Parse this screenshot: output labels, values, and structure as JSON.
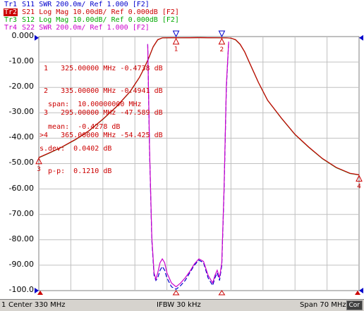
{
  "traces": [
    {
      "id": "Tr1",
      "label": "Tr1",
      "param": "S11",
      "format": "SWR",
      "scale": "200.0m/",
      "ref": "Ref 1.000",
      "channel": "[F2]",
      "color": "#0000cc",
      "active": false
    },
    {
      "id": "Tr2",
      "label": "Tr2",
      "param": "S21",
      "format": "Log Mag",
      "scale": "10.00dB/",
      "ref": "Ref 0.000dB",
      "channel": "[F2]",
      "color": "#cc0000",
      "active": true
    },
    {
      "id": "Tr3",
      "label": "Tr3",
      "param": "S12",
      "format": "Log Mag",
      "scale": "10.00dB/",
      "ref": "Ref 0.000dB",
      "channel": "[F2]",
      "color": "#00aa00",
      "active": false
    },
    {
      "id": "Tr4",
      "label": "Tr4",
      "param": "S22",
      "format": "SWR",
      "scale": "200.0m/",
      "ref": "Ref 1.000",
      "channel": "[F2]",
      "color": "#cc00cc",
      "active": false
    }
  ],
  "y_axis": {
    "ticks": [
      "0.000",
      "-10.00",
      "-20.00",
      "-30.00",
      "-40.00",
      "-50.00",
      "-60.00",
      "-70.00",
      "-80.00",
      "-90.00",
      "-100.0"
    ]
  },
  "markers": {
    "rows": [
      {
        "label": " 1",
        "freq": "325.00000 MHz",
        "value": "-0.4738 dB"
      },
      {
        "label": " 2",
        "freq": "335.00000 MHz",
        "value": "-0.4941 dB"
      },
      {
        "label": " 3",
        "freq": "295.00000 MHz",
        "value": "-47.589 dB"
      },
      {
        "label": ">4",
        "freq": "365.00000 MHz",
        "value": "-54.425 dB"
      }
    ],
    "plot_labels": [
      "1",
      "2",
      "3",
      "4"
    ]
  },
  "statistics": {
    "rows": [
      {
        "name": "  span:",
        "value": "10.00000000 MHz"
      },
      {
        "name": "  mean:",
        "value": "-0.4278 dB"
      },
      {
        "name": "s.dev:",
        "value": "0.0402 dB"
      },
      {
        "name": "  p-p:",
        "value": "0.1210 dB"
      }
    ]
  },
  "status_bar": {
    "channel": "1",
    "center": "Center 330 MHz",
    "ifbw": "IFBW 30 kHz",
    "span": "Span 70 MHz",
    "cor": "Cor"
  },
  "colors": {
    "grid": "#c0c0c0",
    "s21": "#cc0000",
    "s12": "#228b22",
    "s11": "#0000cc",
    "s22": "#cc00cc",
    "marker": "#cc0000",
    "ref_marker": "#0000cc"
  },
  "chart_data": {
    "type": "line",
    "x_unit": "MHz",
    "xlim": [
      295,
      365
    ],
    "ylim": [
      -100,
      0
    ],
    "series": [
      {
        "name": "S21",
        "color": "#cc0000",
        "x": [
          295,
          297,
          300,
          303,
          306,
          309,
          312,
          315,
          317,
          318,
          319,
          320,
          321,
          322,
          324,
          326,
          328,
          330,
          332,
          334,
          336,
          337,
          338,
          339,
          340,
          341,
          342,
          343,
          344,
          345,
          348,
          351,
          354,
          357,
          360,
          363,
          365
        ],
        "y": [
          -47.6,
          -46,
          -43.5,
          -40.5,
          -37,
          -32.5,
          -27.5,
          -21.5,
          -16,
          -12.5,
          -8.5,
          -4,
          -1.2,
          -0.5,
          -0.45,
          -0.47,
          -0.44,
          -0.42,
          -0.45,
          -0.48,
          -0.5,
          -0.6,
          -1.2,
          -3,
          -6,
          -10,
          -14,
          -18,
          -21.5,
          -25,
          -32,
          -38.5,
          -43.5,
          -48,
          -51.5,
          -53.8,
          -54.4
        ]
      },
      {
        "name": "S12",
        "color": "#228b22",
        "x": [
          295,
          297,
          300,
          303,
          306,
          309,
          312,
          315,
          317,
          318,
          319,
          320,
          321,
          322,
          324,
          326,
          328,
          330,
          332,
          334,
          336,
          337,
          338,
          339,
          340,
          341,
          342,
          343,
          344,
          345,
          348,
          351,
          354,
          357,
          360,
          363,
          365
        ],
        "y": [
          -47.7,
          -46.1,
          -43.6,
          -40.6,
          -37.1,
          -32.6,
          -27.6,
          -21.6,
          -16.1,
          -12.6,
          -8.6,
          -4.1,
          -1.3,
          -0.5,
          -0.45,
          -0.47,
          -0.44,
          -0.42,
          -0.45,
          -0.48,
          -0.5,
          -0.6,
          -1.3,
          -3.1,
          -6.1,
          -10.1,
          -14.1,
          -18.1,
          -21.6,
          -25.1,
          -32.1,
          -38.6,
          -43.6,
          -48.1,
          -51.6,
          -53.9,
          -54.5
        ]
      },
      {
        "name": "S11",
        "color": "#0000cc",
        "x": [
          318.8,
          319.2,
          319.7,
          320.2,
          320.6,
          321,
          321.5,
          322,
          322.5,
          323,
          324,
          325,
          326,
          327,
          328,
          329,
          330,
          331,
          332,
          333,
          333.5,
          334,
          334.5,
          335,
          335.5,
          336,
          336.5
        ],
        "y": [
          -3,
          -45,
          -80,
          -94,
          -96,
          -95,
          -92,
          -90.5,
          -92,
          -95,
          -98.5,
          -99.5,
          -98,
          -96,
          -93,
          -90,
          -88,
          -89,
          -95,
          -98,
          -95,
          -93,
          -96,
          -90,
          -60,
          -20,
          -2
        ]
      },
      {
        "name": "S22",
        "color": "#cc00cc",
        "x": [
          318.8,
          319.2,
          319.7,
          320.2,
          320.6,
          321,
          321.5,
          322,
          322.5,
          323,
          324,
          325,
          326,
          327,
          328,
          329,
          330,
          331,
          332,
          333,
          333.5,
          334,
          334.5,
          335,
          335.5,
          336,
          336.5
        ],
        "y": [
          -3,
          -44,
          -79,
          -93,
          -95.5,
          -93,
          -89,
          -87.5,
          -89,
          -93,
          -97,
          -98.5,
          -97,
          -95,
          -92.5,
          -89.5,
          -87.5,
          -88.5,
          -94,
          -97,
          -94,
          -92,
          -95,
          -89,
          -59,
          -19,
          -2
        ]
      }
    ],
    "markers": [
      {
        "label": "1",
        "x": 325,
        "y": -0.4738
      },
      {
        "label": "2",
        "x": 335,
        "y": -0.4941
      },
      {
        "label": "3",
        "x": 295,
        "y": -47.589
      },
      {
        "label": "4",
        "x": 365,
        "y": -54.425
      }
    ]
  }
}
